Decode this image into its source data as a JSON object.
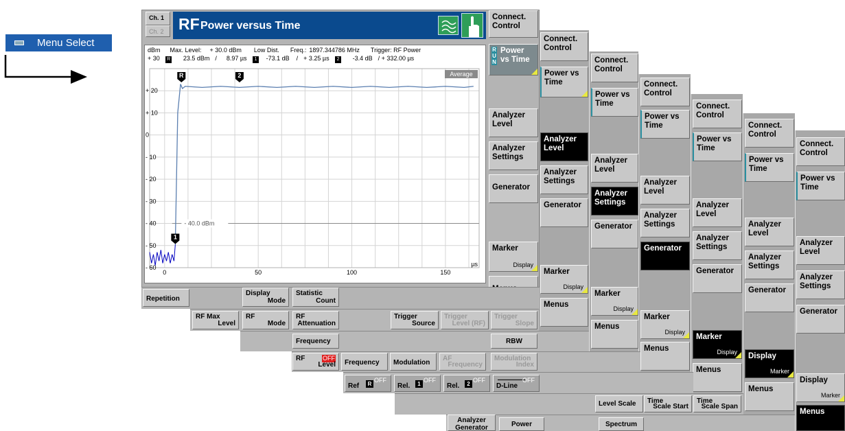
{
  "menu_select": {
    "label": "Menu Select"
  },
  "window": {
    "ch1": "Ch. 1",
    "ch2": "Ch. 2",
    "title_rf": "RF",
    "title_rest": "Power versus Time",
    "colors": {
      "title_bg": "#0a4a8e",
      "title_text": "#ffffff",
      "trace": "#5b7fb0",
      "trace_start": "#0000c0",
      "highlight": "#2a8fa0",
      "off_red": "#e02020",
      "softkey_yellow": "#e8e840"
    }
  },
  "readout": {
    "unit": "dBm",
    "max_level_label": "Max. Level:",
    "max_level_value": "+ 30.0  dBm",
    "low_dist_label": "Low Dist.",
    "freq_label": "Freq.:",
    "freq_value": "1897.344786  MHz",
    "trigger_label": "Trigger: RF Power",
    "ref_top": "+ 30",
    "m1_value": "23.5  dBm",
    "m1_sep": "/",
    "m1_time": "8.97  µs",
    "m2_low": "-73.1  dB",
    "m2_sep": "/",
    "m2_time": "+ 3.25  µs",
    "m3_db": "-3.4  dB",
    "m3_time": "/ + 332.00  µs"
  },
  "chart_data": {
    "type": "line",
    "title": "",
    "xlabel": "µs",
    "ylabel": "dBm",
    "xlim": [
      -8,
      168
    ],
    "ylim": [
      -60,
      30
    ],
    "x_ticks": [
      "0",
      "50",
      "100",
      "150"
    ],
    "y_ticks": [
      "+ 20",
      "+ 10",
      "0",
      "- 10",
      "- 20",
      "- 30",
      "- 40",
      "- 50",
      "- 60"
    ],
    "average_label": "Average",
    "limit_line": {
      "value": -40,
      "label": "- 40.0 dBm"
    },
    "markers": [
      {
        "label": "R",
        "x": 8.97,
        "y": 23.5
      },
      {
        "label": "2",
        "x": 40,
        "y": 23.5
      },
      {
        "label": "1",
        "x": 5.7,
        "y": -49.6
      }
    ],
    "series": [
      {
        "points": [
          [
            -8,
            -53
          ],
          [
            -7,
            -58
          ],
          [
            -6,
            -54
          ],
          [
            -5,
            -59
          ],
          [
            -4,
            -53
          ],
          [
            -3,
            -57
          ],
          [
            -2,
            -52
          ],
          [
            -1,
            -58
          ],
          [
            0,
            -54
          ],
          [
            1,
            -57
          ],
          [
            2,
            -53
          ],
          [
            3,
            -58
          ],
          [
            4,
            -54
          ],
          [
            5,
            -57
          ],
          [
            5.7,
            -49.6
          ],
          [
            7,
            10
          ],
          [
            8.5,
            23
          ],
          [
            9.5,
            21
          ],
          [
            11,
            22
          ],
          [
            20,
            21.5
          ],
          [
            30,
            22
          ],
          [
            40,
            21.5
          ],
          [
            50,
            22
          ],
          [
            60,
            21.5
          ],
          [
            70,
            22
          ],
          [
            80,
            21.5
          ],
          [
            90,
            22
          ],
          [
            100,
            21.5
          ],
          [
            110,
            22
          ],
          [
            120,
            21.5
          ],
          [
            130,
            22
          ],
          [
            140,
            21.5
          ],
          [
            150,
            22
          ],
          [
            160,
            21.5
          ],
          [
            165,
            22
          ]
        ]
      }
    ]
  },
  "side_col1": {
    "connect": "Connect. Control",
    "power": "Power vs Time",
    "run": "R U N",
    "level": "Analyzer Level",
    "settings": "Analyzer Settings",
    "generator": "Generator",
    "marker": "Marker",
    "display": "Display",
    "menus": "Menus"
  },
  "softkeys": {
    "repetition": "Repetition",
    "display": "Display",
    "display_sub": "Mode",
    "statistic": "Statistic",
    "statistic_sub": "Count",
    "rf_max": "RF Max",
    "rf_max_sub": "Level",
    "rf": "RF",
    "rf_sub": "Mode",
    "rf_att": "RF",
    "rf_att_sub": "Attenuation",
    "trig_source": "Trigger",
    "trig_source_sub": "Source",
    "trig_level": "Trigger",
    "trig_level_sub": "Level (RF)",
    "trig_slope": "Trigger",
    "trig_slope_sub": "Slope",
    "frequency": "Frequency",
    "rbw": "RBW",
    "rf_level": "RF",
    "rf_level_sub": "Level",
    "off": "OFF",
    "frequency2": "Frequency",
    "modulation": "Modulation",
    "af": "AF",
    "af_sub": "Frequency",
    "mod_index": "Modulation",
    "mod_index_sub": "Index",
    "ref": "Ref",
    "rel1": "Rel.",
    "rel2": "Rel.",
    "dline": "D-Line",
    "level_scale": "Level Scale",
    "time_start": "Time",
    "time_start_sub": "Scale Start",
    "time_span": "Time",
    "time_span_sub": "Scale Span",
    "an_gen": "Analyzer",
    "an_gen_sub": "Generator",
    "power": "Power",
    "spectrum": "Spectrum"
  },
  "stack": {
    "connect": "Connect. Control",
    "power": "Power vs Time",
    "level": "Analyzer Level",
    "settings": "Analyzer Settings",
    "generator": "Generator",
    "marker": "Marker",
    "marker_sub": "Display",
    "display": "Display",
    "display_sub": "Marker",
    "menus": "Menus"
  }
}
